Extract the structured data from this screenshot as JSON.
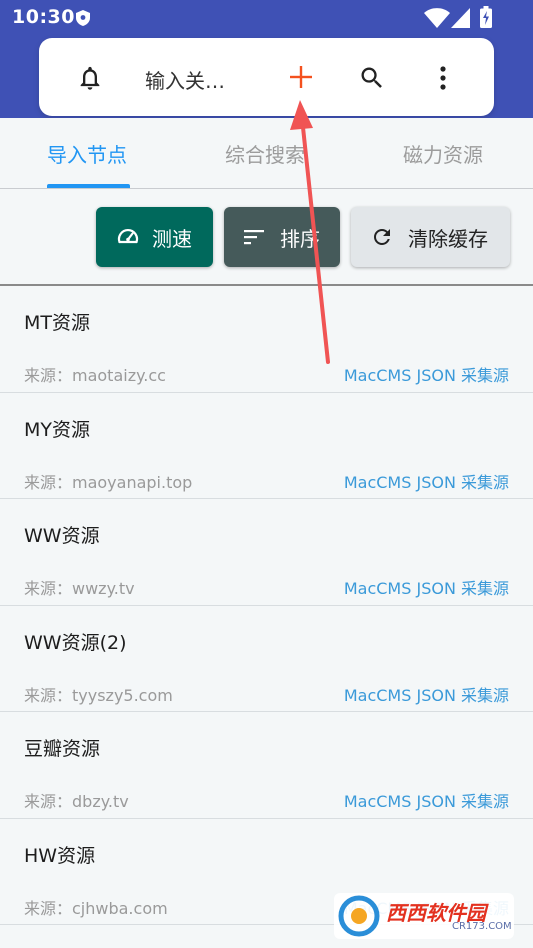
{
  "statusbar": {
    "time": "10:30"
  },
  "searchbar": {
    "placeholder_text": "输入关…"
  },
  "tabs": [
    {
      "label": "导入节点",
      "active": true
    },
    {
      "label": "综合搜索",
      "active": false
    },
    {
      "label": "磁力资源",
      "active": false
    }
  ],
  "actions": {
    "speed_label": "测速",
    "sort_label": "排序",
    "clear_label": "清除缓存"
  },
  "sources": [
    {
      "name": "MT资源",
      "source": "来源：maotaizy.cc",
      "type": "MacCMS JSON 采集源"
    },
    {
      "name": "MY资源",
      "source": "来源：maoyanapi.top",
      "type": "MacCMS JSON 采集源"
    },
    {
      "name": "WW资源",
      "source": "来源：wwzy.tv",
      "type": "MacCMS JSON 采集源"
    },
    {
      "name": "WW资源(2)",
      "source": "来源：tyyszy5.com",
      "type": "MacCMS JSON 采集源"
    },
    {
      "name": "豆瓣资源",
      "source": "来源：dbzy.tv",
      "type": "MacCMS JSON 采集源"
    },
    {
      "name": "HW资源",
      "source": "来源：cjhwba.com",
      "type": "MacCMS JSON 采集源"
    }
  ],
  "watermark": {
    "brand": "西西软件园",
    "domain": "CR173.COM"
  },
  "colors": {
    "header": "#3f51b5",
    "accent_blue": "#2196f3",
    "speed_button": "#00695c",
    "sort_button": "#455a5a",
    "clear_button": "#e2e6e9",
    "plus_icon": "#f4511e",
    "arrow": "#f05454",
    "link_text": "#3b9ad9"
  }
}
